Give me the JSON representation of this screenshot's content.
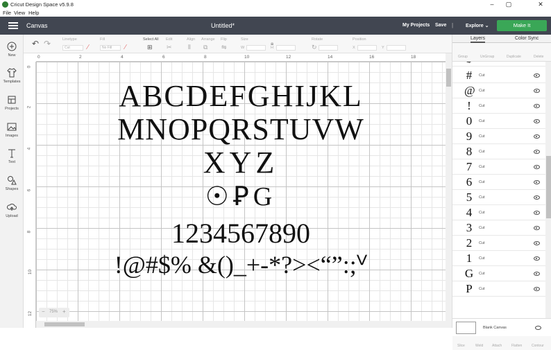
{
  "window": {
    "title": "Cricut Design Space  v5.9.8",
    "controls": [
      "–",
      "▢",
      "✕"
    ]
  },
  "menu": [
    "File",
    "View",
    "Help"
  ],
  "header": {
    "section": "Canvas",
    "document_title": "Untitled*",
    "my_projects": "My Projects",
    "save": "Save",
    "separator": "|",
    "explore": "Explore",
    "make_it": "Make It"
  },
  "left_nav": [
    {
      "label": "New",
      "icon": "plus-icon"
    },
    {
      "label": "Templates",
      "icon": "shirt-icon"
    },
    {
      "label": "Projects",
      "icon": "projects-icon"
    },
    {
      "label": "Images",
      "icon": "image-icon"
    },
    {
      "label": "Text",
      "icon": "text-icon"
    },
    {
      "label": "Shapes",
      "icon": "shapes-icon"
    },
    {
      "label": "Upload",
      "icon": "upload-icon"
    }
  ],
  "toolbar": {
    "linetype_label": "Linetype",
    "linetype_value": "Cut",
    "fill_label": "Fill",
    "fill_value": "No Fill",
    "select_all": "Select All",
    "edit": "Edit",
    "align": "Align",
    "arrange": "Arrange",
    "flip": "Flip",
    "size": "Size",
    "size_w": "W",
    "size_h": "H",
    "rotate": "Rotate",
    "position": "Position",
    "pos_x": "X",
    "pos_y": "Y"
  },
  "ruler": {
    "h_ticks": [
      "0",
      "2",
      "4",
      "6",
      "8",
      "10",
      "12",
      "14",
      "16",
      "18"
    ],
    "v_ticks": [
      "0",
      "2",
      "4",
      "6",
      "8",
      "10",
      "12"
    ]
  },
  "canvas_text": {
    "line1": "ABCDEFGHIJKL",
    "line2": "MNOPQRSTUVW",
    "line3": "XYZ",
    "line4": "☉ꝐG",
    "line5": "1234567890",
    "line6": "!@#$%  &()_+-*?><“”:;ⱽ"
  },
  "zoom": {
    "minus": "−",
    "value": "75%",
    "plus": "+"
  },
  "right_panel": {
    "tabs": [
      "Layers",
      "Color Sync"
    ],
    "tools": [
      "Group",
      "UnGroup",
      "Duplicate",
      "Delete"
    ],
    "layers": [
      {
        "glyph": "$",
        "type": ""
      },
      {
        "glyph": "#",
        "type": "Cut"
      },
      {
        "glyph": "@",
        "type": "Cut"
      },
      {
        "glyph": "!",
        "type": "Cut"
      },
      {
        "glyph": "0",
        "type": "Cut"
      },
      {
        "glyph": "9",
        "type": "Cut"
      },
      {
        "glyph": "8",
        "type": "Cut"
      },
      {
        "glyph": "7",
        "type": "Cut"
      },
      {
        "glyph": "6",
        "type": "Cut"
      },
      {
        "glyph": "5",
        "type": "Cut"
      },
      {
        "glyph": "4",
        "type": "Cut"
      },
      {
        "glyph": "3",
        "type": "Cut"
      },
      {
        "glyph": "2",
        "type": "Cut"
      },
      {
        "glyph": "1",
        "type": "Cut"
      },
      {
        "glyph": "G",
        "type": "Cut"
      },
      {
        "glyph": "P",
        "type": "Cut"
      }
    ],
    "blank_canvas": "Blank Canvas",
    "bottom_tools": [
      "Slice",
      "Weld",
      "Attach",
      "Flatten",
      "Contour"
    ]
  }
}
